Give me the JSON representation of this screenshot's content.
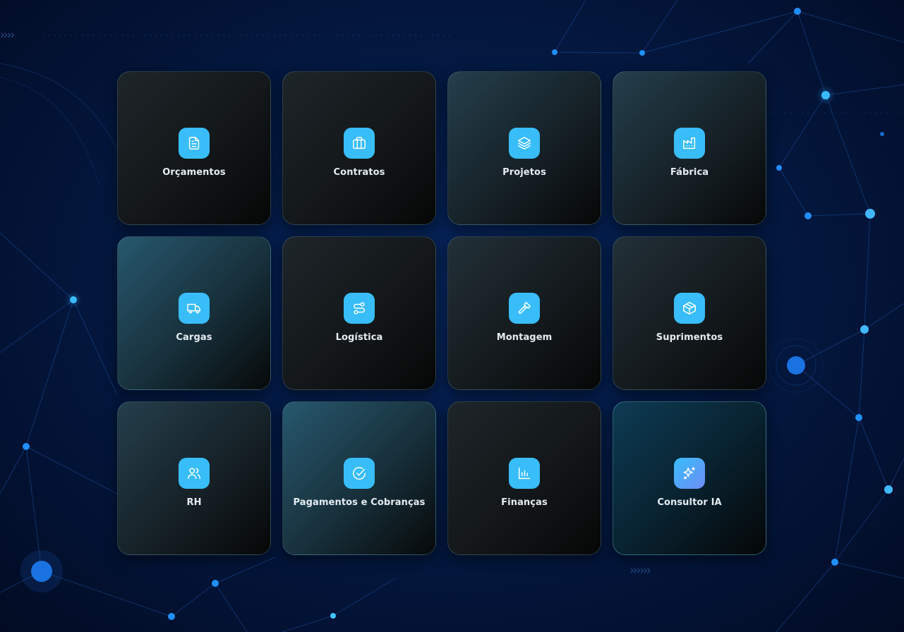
{
  "colors": {
    "accent": "#38bdf8",
    "accent_gradient_end": "#6d8cf7",
    "label": "#e6edf2",
    "background": "#041a44"
  },
  "tiles": [
    {
      "label": "Orçamentos",
      "icon": "file-text-icon"
    },
    {
      "label": "Contratos",
      "icon": "briefcase-icon"
    },
    {
      "label": "Projetos",
      "icon": "layers-icon"
    },
    {
      "label": "Fábrica",
      "icon": "factory-icon"
    },
    {
      "label": "Cargas",
      "icon": "truck-icon"
    },
    {
      "label": "Logística",
      "icon": "route-icon"
    },
    {
      "label": "Montagem",
      "icon": "hammer-icon"
    },
    {
      "label": "Suprimentos",
      "icon": "package-icon"
    },
    {
      "label": "RH",
      "icon": "users-icon"
    },
    {
      "label": "Pagamentos e Cobranças",
      "icon": "check-circle-icon"
    },
    {
      "label": "Finanças",
      "icon": "bar-chart-icon"
    },
    {
      "label": "Consultor IA",
      "icon": "sparkles-icon"
    }
  ]
}
